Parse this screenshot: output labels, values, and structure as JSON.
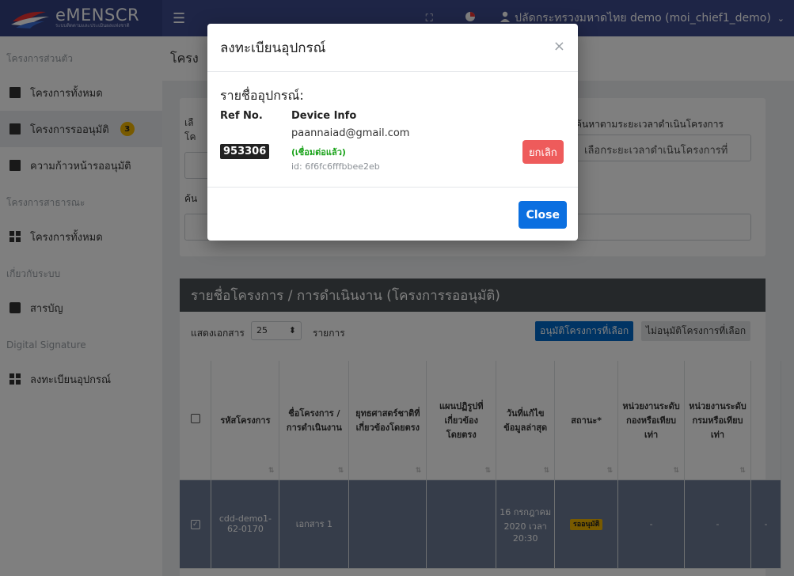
{
  "app": {
    "brand_title": "eMENSCR",
    "brand_subtitle": "ระบบติดตามและประเมินผลแห่งชาติ"
  },
  "topbar": {
    "user_name": "ปลัดกระทรวงมหาดไทย demo (moi_chief1_demo)"
  },
  "sidebar": {
    "sections": [
      {
        "label": "โครงการส่วนตัว"
      },
      {
        "label": "โครงการสาธารณะ"
      },
      {
        "label": "เกี่ยวกับระบบ"
      },
      {
        "label": "Digital Signature"
      }
    ],
    "items": [
      {
        "label": "โครงการทั้งหมด",
        "icon": "document-icon"
      },
      {
        "label": "โครงการรออนุมัติ",
        "icon": "document-icon",
        "badge": "3",
        "active": true
      },
      {
        "label": "ความก้าวหน้ารออนุมัติ",
        "icon": "document-icon"
      },
      {
        "label": "โครงการทั้งหมด",
        "icon": "grid-icon"
      },
      {
        "label": "สารบัญ",
        "icon": "book-icon"
      },
      {
        "label": "ลงทะเบียนอุปกรณ์",
        "icon": "grid-icon"
      }
    ]
  },
  "main": {
    "page_title": "โครง",
    "filters": {
      "select_label_1": "เลื",
      "select_label_2": "โค",
      "search_label": "ค้น",
      "period_label": "ค้นหาตามระยะเวลาดำเนินโครงการ",
      "period_placeholder": "เลือกระยะเวลาดำเนินโครงการที่"
    },
    "list": {
      "title": "รายชื่อโครงการ / การดำเนินงาน (โครงการรออนุมัติ)",
      "length_label": "แสดงเอกสาร",
      "length_value": "25",
      "length_suffix": "รายการ",
      "approve_selected": "อนุมัติโครงการที่เลือก",
      "reject_selected": "ไม่อนุมัติโครงการที่เลือก",
      "columns": [
        "รหัสโครงการ",
        "ชื่อโครงการ / การดำเนินงาน",
        "ยุทธศาสตร์ชาติที่เกี่ยวข้องโดยตรง",
        "แผนปฏิรูปที่เกี่ยวข้องโดยตรง",
        "วันที่แก้ไขข้อมูลล่าสุด",
        "สถานะ*",
        "หน่วยงานระดับกองหรือเทียบเท่า",
        "หน่วยงานระดับกรมหรือเทียบเท่า"
      ],
      "rows": [
        {
          "code": "cdd-demo1-62-0170",
          "name": "เอกสาร 1",
          "strategy": "",
          "reform": "",
          "updated": "16 กรกฎาคม 2020 เวลา 20:30",
          "status": "รออนุมัติ",
          "division": "-",
          "department": "-",
          "extra": "-"
        }
      ]
    }
  },
  "modal": {
    "title": "ลงทะเบียนอุปกรณ์",
    "list_title": "รายชื่ออุปกรณ์:",
    "col_ref": "Ref No.",
    "col_device": "Device Info",
    "ref_no": "953306",
    "email": "paannaiad@gmail.com",
    "status": "(เชื่อมต่อแล้ว)",
    "device_id": "id: 6f6fc6fffbbee2eb",
    "cancel_label": "ยกเลิก",
    "close_label": "Close",
    "colors": {
      "primary": "#0b6fe0",
      "danger": "#ee5b5b",
      "success": "#1ba31b"
    }
  }
}
